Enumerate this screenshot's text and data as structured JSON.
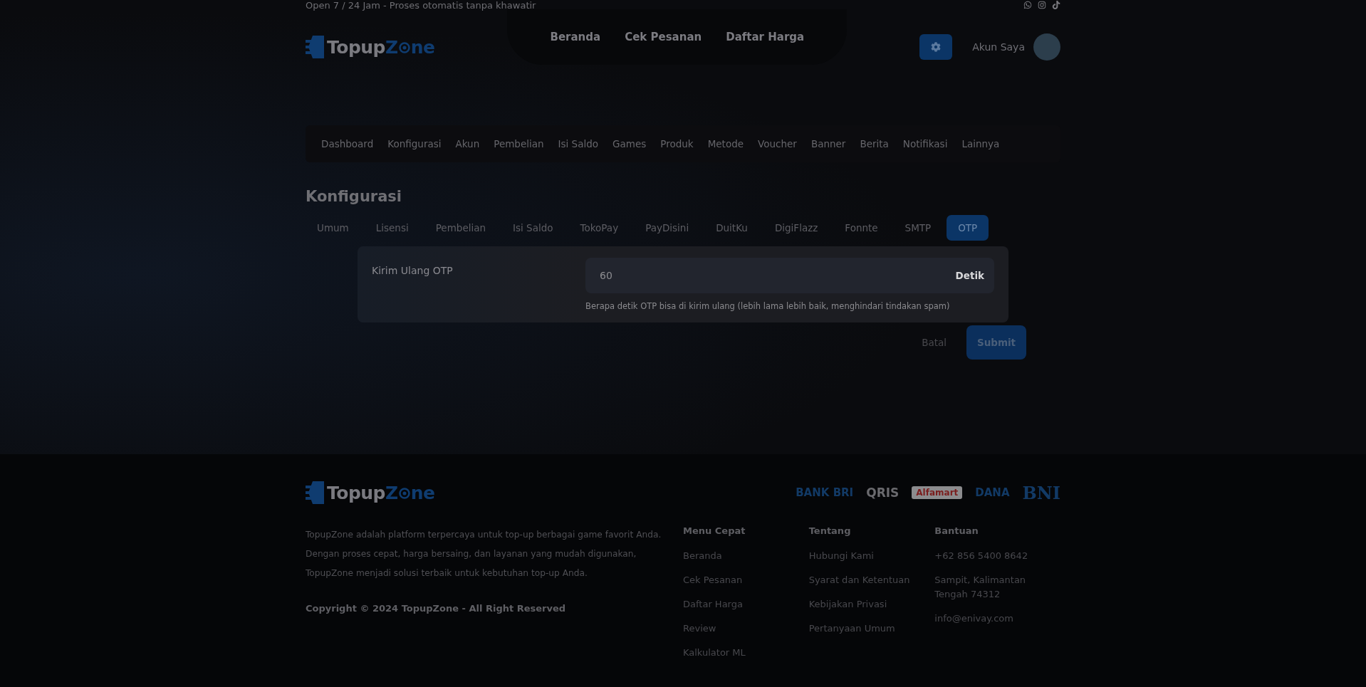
{
  "topbar": {
    "text": "Open 7 / 24 Jam - Proses otomatis tanpa khawatir"
  },
  "header": {
    "logo": {
      "part1": "Topup",
      "part2": "Z",
      "part3": "ne"
    },
    "nav": [
      "Beranda",
      "Cek Pesanan",
      "Daftar Harga"
    ],
    "account": "Akun Saya"
  },
  "admin_nav": [
    {
      "label": "Dashboard",
      "selected": false
    },
    {
      "label": "Konfigurasi",
      "selected": false
    },
    {
      "label": "Akun",
      "selected": false
    },
    {
      "label": "Pembelian",
      "selected": false
    },
    {
      "label": "Isi Saldo",
      "selected": false
    },
    {
      "label": "Games",
      "selected": false
    },
    {
      "label": "Produk",
      "selected": false
    },
    {
      "label": "Metode",
      "selected": false
    },
    {
      "label": "Voucher",
      "selected": false
    },
    {
      "label": "Banner",
      "selected": false
    },
    {
      "label": "Berita",
      "selected": false
    },
    {
      "label": "Notifikasi",
      "selected": false
    },
    {
      "label": "Lainnya",
      "selected": false
    }
  ],
  "page_title": "Konfigurasi",
  "tabs": [
    {
      "label": "Umum",
      "selected": false
    },
    {
      "label": "Lisensi",
      "selected": false
    },
    {
      "label": "Pembelian",
      "selected": false
    },
    {
      "label": "Isi Saldo",
      "selected": false
    },
    {
      "label": "TokoPay",
      "selected": false
    },
    {
      "label": "PayDisini",
      "selected": false
    },
    {
      "label": "DuitKu",
      "selected": false
    },
    {
      "label": "DigiFlazz",
      "selected": false
    },
    {
      "label": "Fonnte",
      "selected": false
    },
    {
      "label": "SMTP",
      "selected": false
    },
    {
      "label": "OTP",
      "selected": true
    }
  ],
  "form": {
    "label": "Kirim Ulang OTP",
    "value": "60",
    "suffix": "Detik",
    "help": "Berapa detik OTP bisa di kirim ulang (lebih lama lebih baik, menghindari tindakan spam)"
  },
  "actions": {
    "cancel": "Batal",
    "submit": "Submit"
  },
  "footer": {
    "logo": {
      "part1": "Topup",
      "part2": "Z",
      "part3": "ne"
    },
    "payments": [
      {
        "kind": "bri",
        "label": "BANK BRI"
      },
      {
        "kind": "qris",
        "label": "QRIS"
      },
      {
        "kind": "alfamart",
        "label": "Alfamart"
      },
      {
        "kind": "dana",
        "label": "DANA"
      },
      {
        "kind": "bni",
        "label": "BNI"
      }
    ],
    "about": "TopupZone adalah platform terpercaya untuk top-up berbagai game favorit Anda. Dengan proses cepat, harga bersaing, dan layanan yang mudah digunakan, TopupZone menjadi solusi terbaik untuk kebutuhan top-up Anda.",
    "copyright": "Copyright © 2024 TopupZone - All Right Reserved",
    "columns": [
      {
        "title": "Menu Cepat",
        "items": [
          "Beranda",
          "Cek Pesanan",
          "Daftar Harga",
          "Review",
          "Kalkulator ML"
        ]
      },
      {
        "title": "Tentang",
        "items": [
          "Hubungi Kami",
          "Syarat dan Ketentuan",
          "Kebijakan Privasi",
          "Pertanyaan Umum"
        ]
      },
      {
        "title": "Bantuan",
        "items": [
          "+62 856 5400 8642",
          "Sampit, Kalimantan Tengah 74312",
          "info@enivay.com"
        ]
      }
    ]
  }
}
